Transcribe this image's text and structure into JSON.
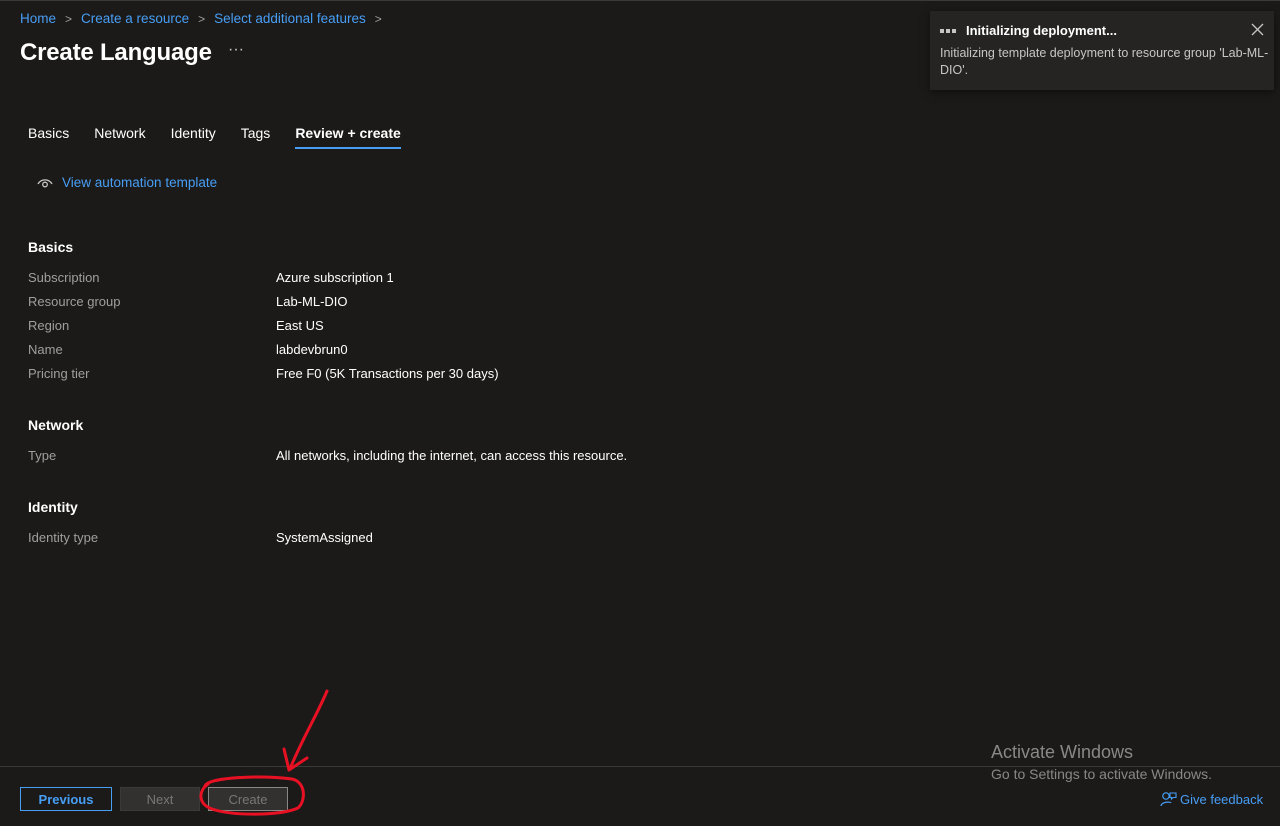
{
  "breadcrumb": {
    "home": "Home",
    "create_resource": "Create a resource",
    "additional_features": "Select additional features",
    "sep": ">"
  },
  "page": {
    "title": "Create Language",
    "more": "···"
  },
  "tabs": [
    {
      "label": "Basics"
    },
    {
      "label": "Network"
    },
    {
      "label": "Identity"
    },
    {
      "label": "Tags"
    },
    {
      "label": "Review + create",
      "active": true
    }
  ],
  "automation": {
    "label": "View automation template",
    "icon": "eye-icon"
  },
  "sections": {
    "basics": {
      "title": "Basics",
      "rows": [
        {
          "key": "Subscription",
          "value": "Azure subscription 1"
        },
        {
          "key": "Resource group",
          "value": "Lab-ML-DIO"
        },
        {
          "key": "Region",
          "value": "East US"
        },
        {
          "key": "Name",
          "value": "labdevbrun0"
        },
        {
          "key": "Pricing tier",
          "value": "Free F0 (5K Transactions per 30 days)"
        }
      ]
    },
    "network": {
      "title": "Network",
      "rows": [
        {
          "key": "Type",
          "value": "All networks, including the internet, can access this resource."
        }
      ]
    },
    "identity": {
      "title": "Identity",
      "rows": [
        {
          "key": "Identity type",
          "value": "SystemAssigned"
        }
      ]
    }
  },
  "toast": {
    "title": "Initializing deployment...",
    "message": "Initializing template deployment to resource group 'Lab-ML-DIO'."
  },
  "footer": {
    "previous": "Previous",
    "next": "Next",
    "create": "Create",
    "feedback": "Give feedback"
  },
  "watermark": {
    "line1": "Activate Windows",
    "line2": "Go to Settings to activate Windows."
  },
  "colors": {
    "background": "#1b1a19",
    "link": "#479ef5",
    "annotation": "#e81123"
  }
}
